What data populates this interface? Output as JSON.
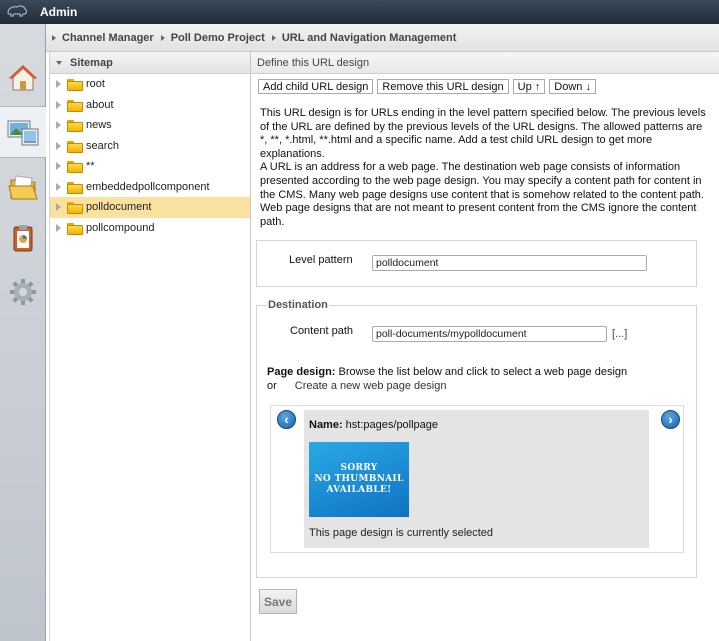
{
  "app": {
    "title": "Admin",
    "logo_icon": "hippo-logo-icon"
  },
  "rail": {
    "items": [
      {
        "name": "home-icon"
      },
      {
        "name": "channel-manager-icon",
        "selected": true
      },
      {
        "name": "documents-folder-icon"
      },
      {
        "name": "reports-icon"
      },
      {
        "name": "settings-gear-icon"
      }
    ]
  },
  "breadcrumb": [
    "Channel Manager",
    "Poll Demo Project",
    "URL and Navigation Management"
  ],
  "sitemap": {
    "header": "Sitemap",
    "items": [
      {
        "label": "root"
      },
      {
        "label": "about"
      },
      {
        "label": "news"
      },
      {
        "label": "search"
      },
      {
        "label": "**"
      },
      {
        "label": "embeddedpollcomponent"
      },
      {
        "label": "polldocument",
        "selected": true
      },
      {
        "label": "pollcompound"
      }
    ]
  },
  "main": {
    "header": "Define this URL design",
    "toolbar": {
      "add_child": "Add child URL design",
      "remove": "Remove this URL design",
      "up": "Up ↑",
      "down": "Down ↓"
    },
    "description": "This URL design is for URLs ending in the level pattern specified below. The previous levels of the URL are defined by the previous levels of the URL designs. The allowed patterns are *, **, *.html, **.html and a specific name. Add a test child URL design to get more explanations.\nA URL is an address for a web page. The destination web page consists of information presented according to the web page design. You may specify a content path for content in the CMS. Many web page designs use content that is somehow related to the content path. Web page designs that are not meant to present content from the CMS ignore the content path.",
    "level_pattern": {
      "label": "Level pattern",
      "value": "polldocument"
    },
    "destination": {
      "legend": "Destination",
      "content_path_label": "Content path",
      "content_path_value": "poll-documents/mypolldocument",
      "browse_label": "[...]",
      "page_design_bold": "Page design:",
      "page_design_text": " Browse the list below and click to select a web page design",
      "or": "or",
      "create_link": "Create a new web page design",
      "card": {
        "name_bold": "Name:",
        "name_value": " hst:pages/pollpage",
        "thumbnail_text": "SORRY\nNO THUMBNAIL\nAVAILABLE!",
        "status": "This page design is currently selected"
      }
    },
    "save": "Save"
  },
  "colors": {
    "selected_row": "#fbe1a0",
    "topbar": "#26323d",
    "accent_blue": "#1b5fa6"
  }
}
